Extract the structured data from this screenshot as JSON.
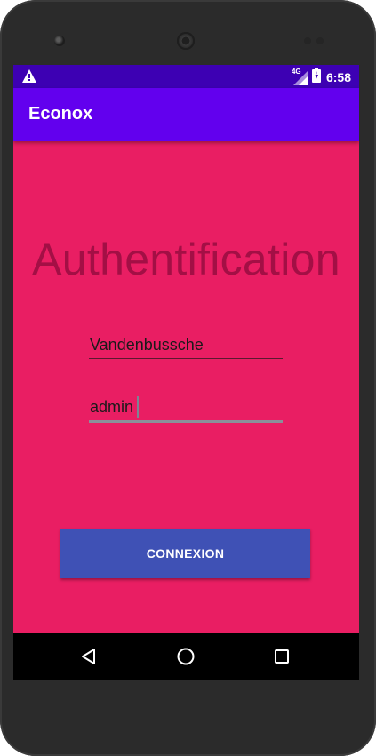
{
  "status_bar": {
    "warning_icon": "warning-icon",
    "network_label": "4G",
    "signal_icon": "signal-icon",
    "battery_icon": "battery-icon",
    "time": "6:58"
  },
  "app_bar": {
    "title": "Econox"
  },
  "main": {
    "heading": "Authentification",
    "username_value": "Vandenbussche",
    "password_value": "admin",
    "connect_label": "CONNEXION"
  },
  "nav_bar": {
    "back_icon": "back-triangle-icon",
    "home_icon": "home-circle-icon",
    "recents_icon": "recents-square-icon"
  },
  "colors": {
    "status_bar": "#3d00b3",
    "app_bar": "#6200ee",
    "background": "#e91e63",
    "heading": "#a30f45",
    "button": "#3f51b5"
  }
}
